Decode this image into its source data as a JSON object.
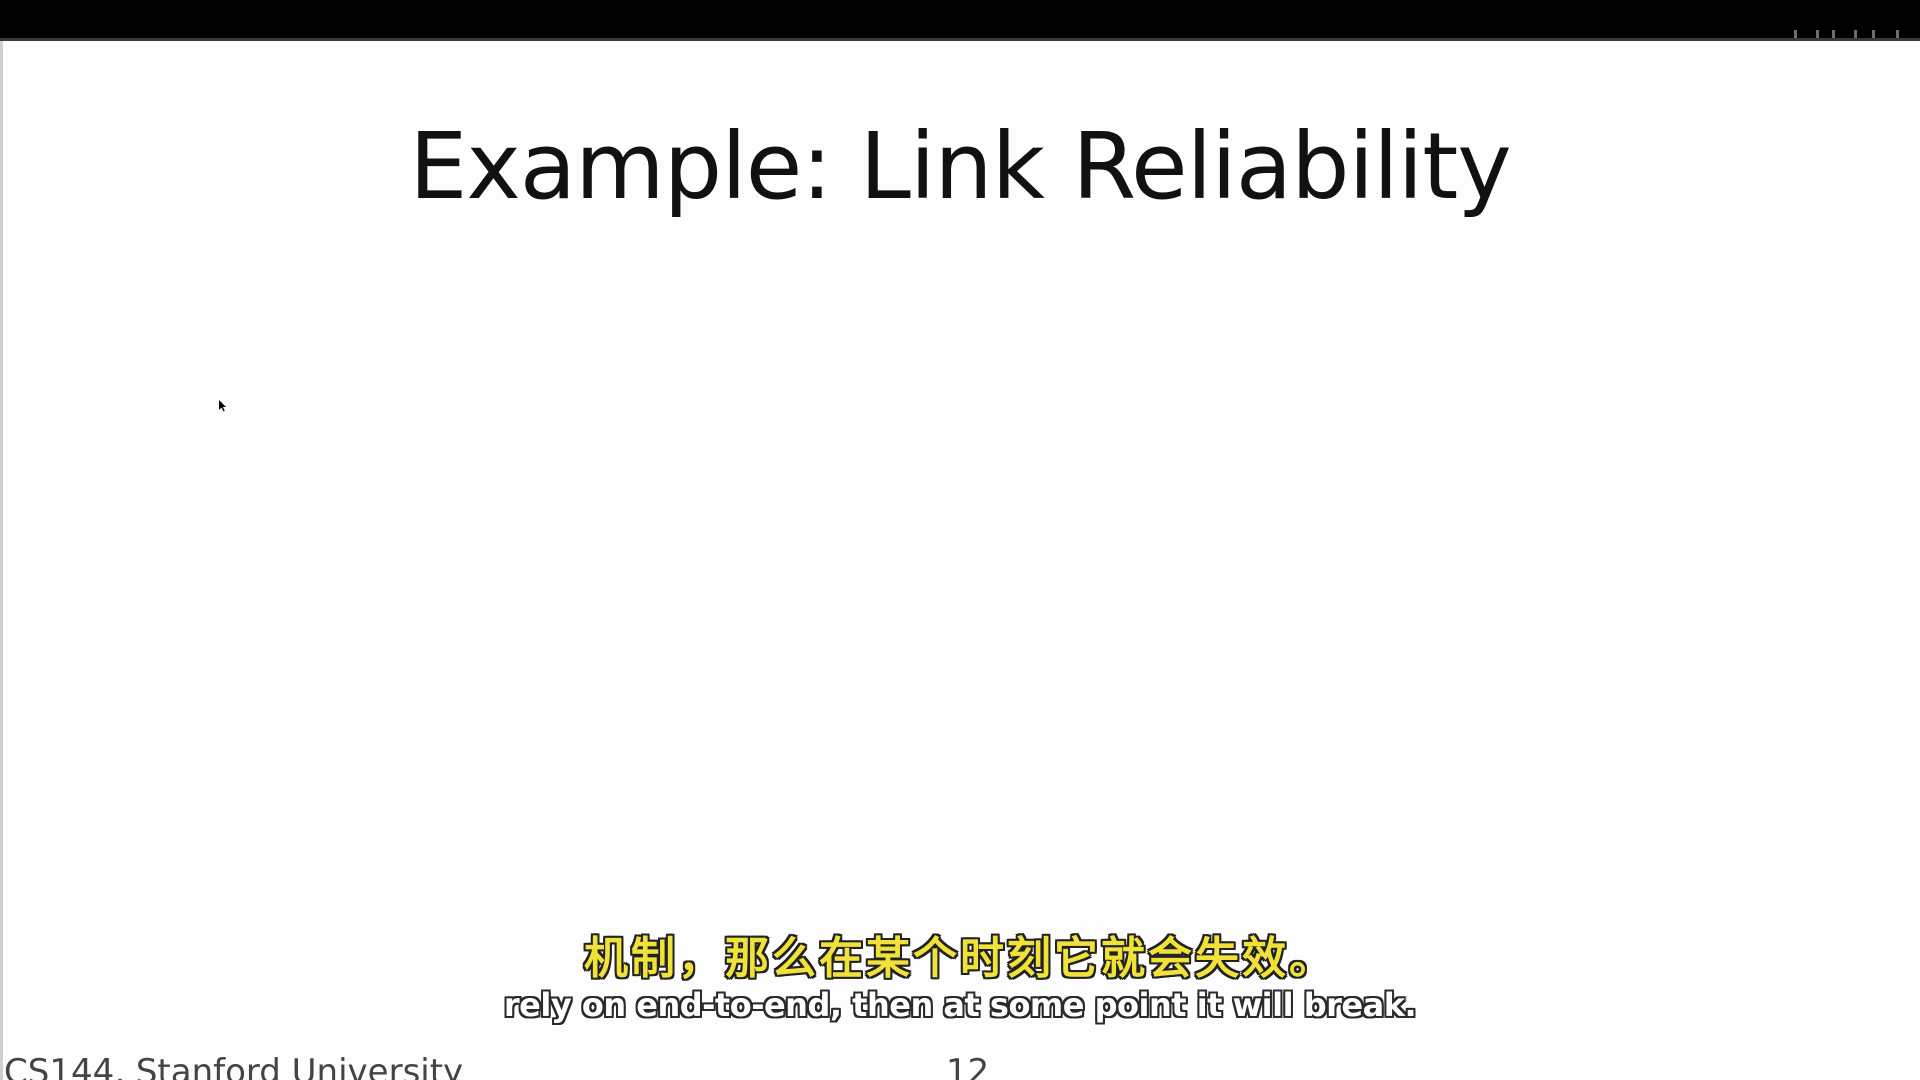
{
  "slide": {
    "title": "Example: Link Reliability",
    "footer_text": "CS144, Stanford University",
    "page_number": "12"
  },
  "subtitles": {
    "chinese": "机制，那么在某个时刻它就会失效。",
    "english": "rely on end-to-end, then at some point it will break."
  },
  "colors": {
    "top_bar": "#000000",
    "slide_background": "#fdfdfd",
    "title_text": "#111111",
    "subtitle_chinese": "#f1e23a",
    "subtitle_english": "#ffffff",
    "footer_text": "#444444"
  },
  "icons": {
    "cursor": "mouse-pointer-icon"
  }
}
